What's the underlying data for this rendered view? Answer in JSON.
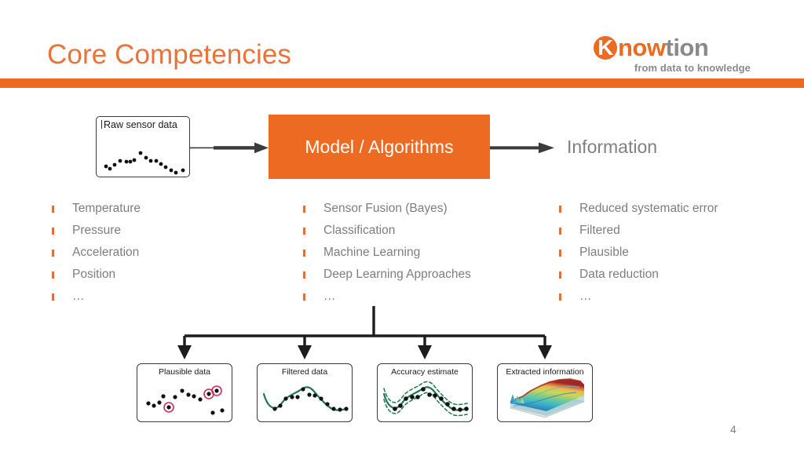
{
  "slide": {
    "title": "Core Competencies",
    "page_number": "4",
    "accent_color": "#EC6A21",
    "title_color": "#E8743B",
    "body_text_color": "#7E7E7E"
  },
  "logo": {
    "badge_letter": "K",
    "word_part_1": "now",
    "word_part_2": "tion",
    "tagline": "from data to knowledge",
    "orange": "#EC6A21",
    "gray": "#8A8A8A"
  },
  "flow": {
    "input_box": {
      "caption": "Raw sensor data"
    },
    "process_box": {
      "label": "Model / Algorithms"
    },
    "output_label": "Information"
  },
  "columns": {
    "inputs": [
      "Temperature",
      "Pressure",
      "Acceleration",
      "Position",
      "…"
    ],
    "methods": [
      "Sensor Fusion (Bayes)",
      "Classification",
      "Machine Learning",
      "Deep Learning Approaches",
      "…"
    ],
    "outputs": [
      "Reduced systematic error",
      "Filtered",
      "Plausible",
      "Data reduction",
      "…"
    ]
  },
  "results": [
    {
      "caption": "Plausible data"
    },
    {
      "caption": "Filtered data"
    },
    {
      "caption": "Accuracy estimate"
    },
    {
      "caption": "Extracted information"
    }
  ],
  "chart_data": [
    {
      "type": "scatter",
      "title": "Raw sensor data",
      "x": [
        8,
        13,
        18,
        25,
        32,
        39,
        44,
        50,
        57,
        63,
        69,
        75,
        81,
        88,
        94,
        100,
        106
      ],
      "y": [
        43,
        47,
        38,
        33,
        35,
        34,
        24,
        30,
        33,
        33,
        40,
        45,
        50,
        57,
        60,
        56,
        55
      ],
      "grid": false,
      "legend": false
    },
    {
      "type": "scatter",
      "title": "Plausible data",
      "x": [
        9,
        15,
        21,
        27,
        34,
        41,
        47,
        53,
        59,
        65,
        71,
        78,
        85,
        92,
        99,
        106
      ],
      "y": [
        38,
        41,
        37,
        43,
        30,
        33,
        25,
        30,
        31,
        35,
        29,
        27,
        26,
        48,
        45,
        43
      ],
      "outlier_indices": [
        3,
        11,
        12
      ],
      "outlier_color": "#D6285A",
      "grid": false,
      "legend": false
    },
    {
      "type": "line",
      "title": "Filtered data",
      "series": [
        {
          "name": "filtered curve",
          "color": "#1E7A4E",
          "x": [
            4,
            12,
            20,
            28,
            36,
            44,
            52,
            60,
            68,
            76,
            84,
            92,
            100,
            110
          ],
          "y": [
            32,
            42,
            44,
            37,
            36,
            35,
            26,
            31,
            34,
            38,
            44,
            48,
            50,
            49
          ]
        }
      ],
      "points": {
        "color": "#111111",
        "x": [
          14,
          20,
          27,
          34,
          41,
          48,
          55,
          62,
          70,
          78,
          86,
          94,
          104
        ],
        "y": [
          46,
          43,
          38,
          36,
          35,
          27,
          31,
          33,
          36,
          42,
          46,
          50,
          49
        ]
      },
      "grid": false,
      "legend": false
    },
    {
      "type": "line",
      "title": "Accuracy estimate",
      "series": [
        {
          "name": "estimate",
          "color": "#1E7A4E",
          "style": "solid",
          "x": [
            4,
            12,
            20,
            28,
            36,
            44,
            52,
            60,
            68,
            76,
            84,
            92,
            100,
            110
          ],
          "y": [
            32,
            42,
            44,
            37,
            36,
            35,
            26,
            31,
            34,
            38,
            44,
            48,
            50,
            49
          ]
        },
        {
          "name": "upper bound",
          "color": "#1E7A4E",
          "style": "dashed",
          "x": [
            4,
            12,
            20,
            28,
            36,
            44,
            52,
            60,
            68,
            76,
            84,
            92,
            100,
            110
          ],
          "y": [
            24,
            34,
            36,
            29,
            28,
            27,
            18,
            23,
            26,
            30,
            36,
            40,
            42,
            41
          ]
        },
        {
          "name": "lower bound",
          "color": "#1E7A4E",
          "style": "dashed",
          "x": [
            4,
            12,
            20,
            28,
            36,
            44,
            52,
            60,
            68,
            76,
            84,
            92,
            100,
            110
          ],
          "y": [
            40,
            50,
            52,
            45,
            44,
            43,
            34,
            39,
            42,
            46,
            52,
            56,
            58,
            57
          ]
        }
      ],
      "points": {
        "color": "#111111",
        "x": [
          14,
          20,
          27,
          34,
          41,
          48,
          55,
          62,
          70,
          78,
          86,
          94,
          104
        ],
        "y": [
          46,
          43,
          38,
          36,
          35,
          27,
          31,
          33,
          36,
          42,
          46,
          50,
          49
        ]
      },
      "grid": false,
      "legend": false
    },
    {
      "type": "heatmap",
      "title": "Extracted information",
      "render": "3d-surface",
      "colormap": [
        "#3B2A8C",
        "#2E7DBE",
        "#35B9C4",
        "#6FC98A",
        "#CBD64F",
        "#E8B84B",
        "#D6562E",
        "#9E2020"
      ],
      "grid": false,
      "legend": false
    }
  ]
}
